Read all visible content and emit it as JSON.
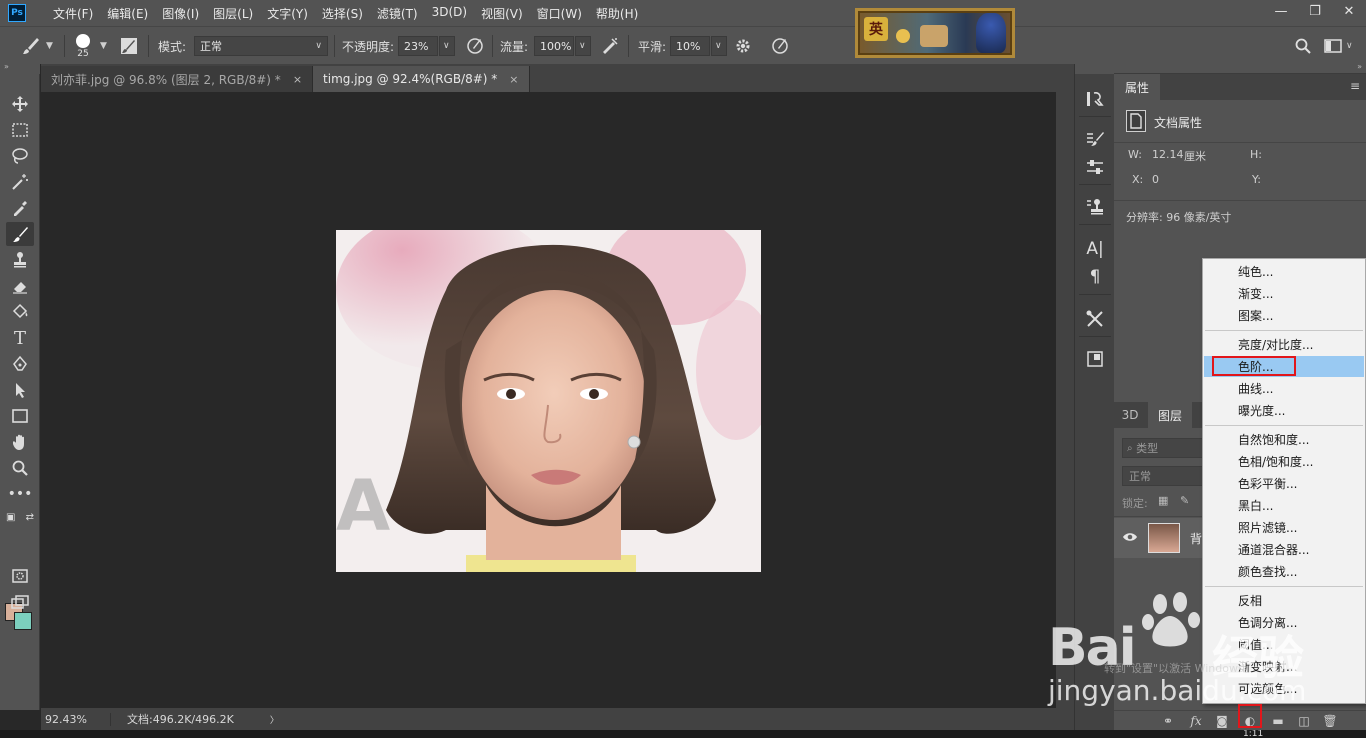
{
  "app": {
    "logo": "Ps"
  },
  "menubar": {
    "items": [
      "文件(F)",
      "编辑(E)",
      "图像(I)",
      "图层(L)",
      "文字(Y)",
      "选择(S)",
      "滤镜(T)",
      "3D(D)",
      "视图(V)",
      "窗口(W)",
      "帮助(H)"
    ],
    "banner_text": "英"
  },
  "window_controls": {
    "minimize": "—",
    "restore": "❐",
    "close": "✕"
  },
  "options": {
    "brush_size": "25",
    "mode_label": "模式:",
    "mode_value": "正常",
    "opacity_label": "不透明度:",
    "opacity_value": "23%",
    "flow_label": "流量:",
    "flow_value": "100%",
    "smooth_label": "平滑:",
    "smooth_value": "10%"
  },
  "tabs": [
    {
      "label": "刘亦菲.jpg @ 96.8% (图层 2, RGB/8#) *",
      "close": "×",
      "active": false
    },
    {
      "label": "timg.jpg @ 92.4%(RGB/8#) *",
      "close": "×",
      "active": true
    }
  ],
  "status": {
    "zoom": "92.43%",
    "doc": "文档:496.2K/496.2K",
    "arrow": "〉"
  },
  "properties": {
    "tab": "属性",
    "section": "文档属性",
    "w_label": "W:",
    "w_value": "12.14",
    "w_unit": "厘米",
    "h_label": "H:",
    "x_label": "X:",
    "x_value": "0",
    "y_label": "Y:",
    "resolution": "分辨率: 96 像素/英寸"
  },
  "layers": {
    "tab_3d": "3D",
    "tab_layers": "图层",
    "search_placeholder": "类型",
    "blend": "正常",
    "lock_label": "锁定:",
    "layer_name": "背"
  },
  "adjust_menu": {
    "items": [
      "纯色...",
      "渐变...",
      "图案...",
      "亮度/对比度...",
      "色阶...",
      "曲线...",
      "曝光度...",
      "自然饱和度...",
      "色相/饱和度...",
      "色彩平衡...",
      "黑白...",
      "照片滤镜...",
      "通道混合器...",
      "颜色查找...",
      "反相",
      "色调分离...",
      "阈值...",
      "渐变映射...",
      "可选颜色..."
    ],
    "highlighted": "色阶..."
  },
  "watermark": {
    "brand": "Bai",
    "brand2": "经验",
    "url": "jingyan.baidu.com",
    "activation": "转到\"设置\"以激活 Windows。"
  },
  "taskbar": {
    "time": "1:11"
  },
  "colors": {
    "accent_red": "#e2161b",
    "menu_highlight": "#99c9f2",
    "foreground": "#d8b09a",
    "background": "#7ccfbe",
    "ps_blue": "#31a8ff"
  }
}
